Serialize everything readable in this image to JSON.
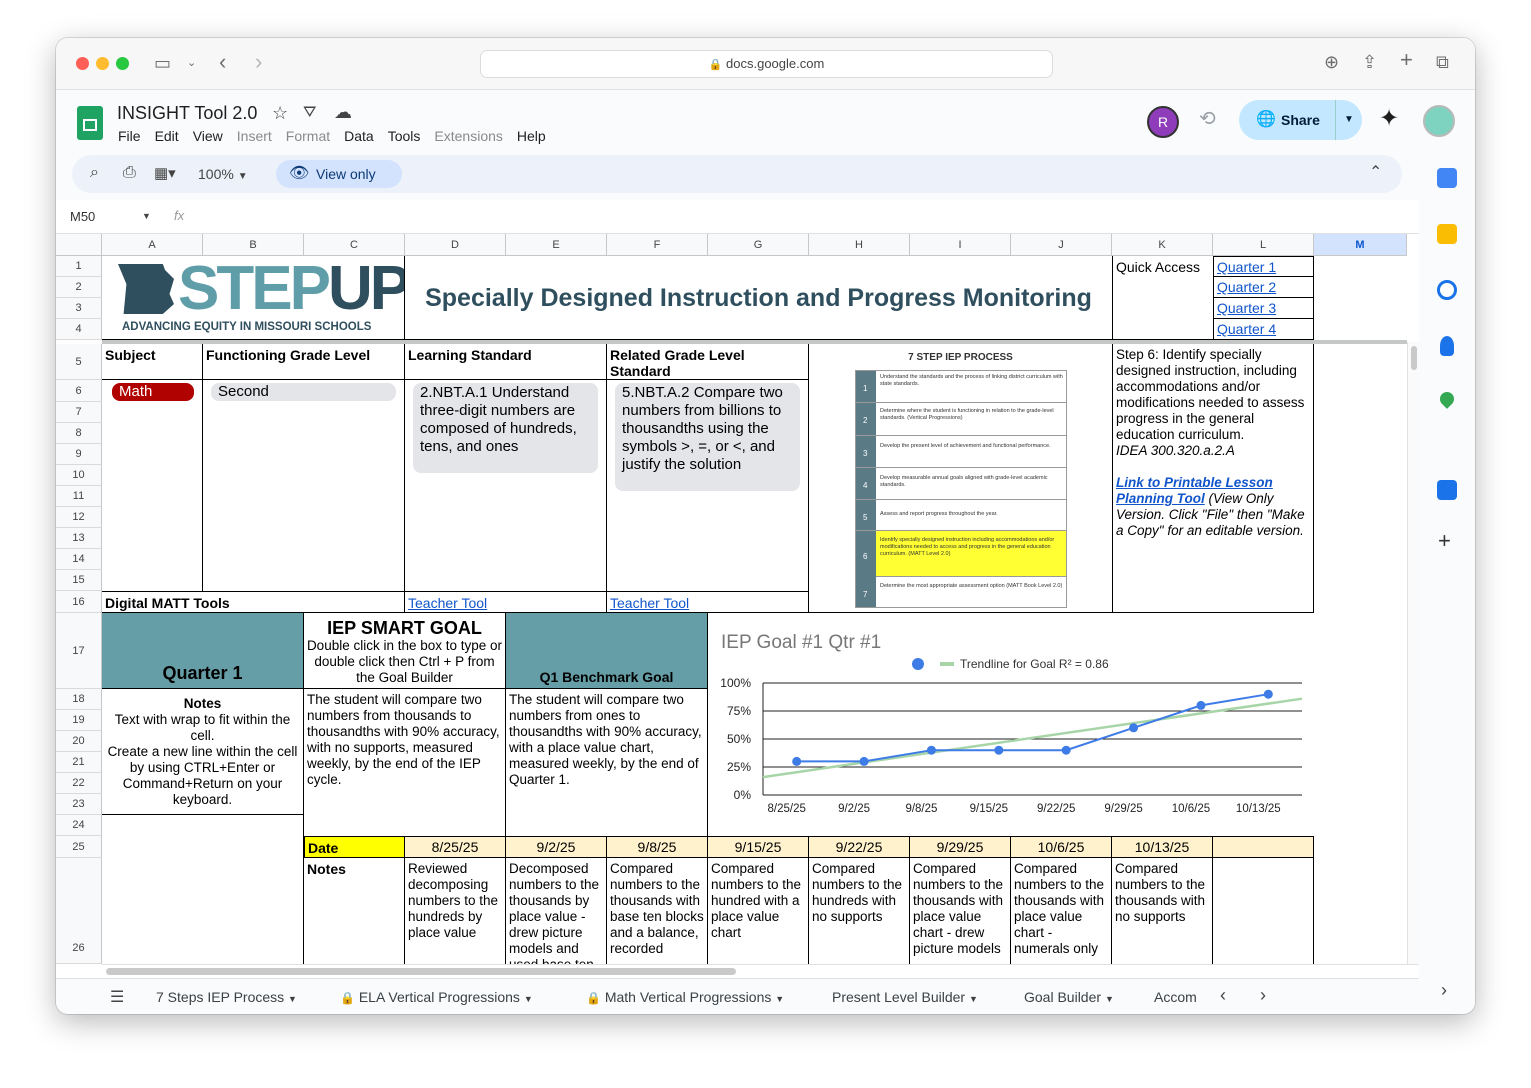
{
  "browser": {
    "url": "docs.google.com"
  },
  "app": {
    "title": "INSIGHT Tool 2.0",
    "menu": [
      "File",
      "Edit",
      "View",
      "Insert",
      "Format",
      "Data",
      "Tools",
      "Extensions",
      "Help"
    ],
    "zoom": "100%",
    "view_only": "View only",
    "share": "Share",
    "avatar_letter": "R",
    "name_box": "M50",
    "fx": "fx"
  },
  "columns": [
    "A",
    "B",
    "C",
    "D",
    "E",
    "F",
    "G",
    "H",
    "I",
    "J",
    "K",
    "L",
    "M"
  ],
  "rows": [
    "1",
    "2",
    "3",
    "4",
    "5",
    "6",
    "7",
    "8",
    "9",
    "10",
    "11",
    "12",
    "13",
    "14",
    "15",
    "16",
    "17",
    "18",
    "19",
    "20",
    "21",
    "22",
    "23",
    "24",
    "25",
    "26"
  ],
  "logo": {
    "word_a": "STEP",
    "word_b": "UP",
    "tagline": "ADVANCING EQUITY IN MISSOURI SCHOOLS"
  },
  "banner_title": "Specially Designed Instruction and Progress Monitoring",
  "quick_access": {
    "label": "Quick Access",
    "links": [
      "Quarter 1",
      "Quarter 2",
      "Quarter 3",
      "Quarter 4"
    ]
  },
  "headers": {
    "subject": "Subject",
    "grade": "Functioning Grade Level",
    "standard": "Learning Standard",
    "related": "Related Grade Level Standard",
    "digital": "Digital MATT Tools"
  },
  "values": {
    "subject": "Math",
    "grade": "Second",
    "standard": "2.NBT.A.1 Understand three-digit numbers are composed of hundreds, tens, and ones",
    "related": "5.NBT.A.2 Compare two numbers from billions to thousandths using the symbols >, =, or <, and justify the solution"
  },
  "teacher_tool": "Teacher Tool",
  "iep_image": {
    "title": "7 STEP IEP PROCESS",
    "steps": [
      "Understand the standards and the process of linking district curriculum with state standards.",
      "Determine where the student is functioning in relation to the grade-level standards. (Vertical Progressions)",
      "Develop the present level of achievement and functional performance.",
      "Develop measurable annual goals aligned with grade-level academic standards.",
      "Assess and report progress throughout the year.",
      "Identify specially designed instruction including accommodations and/or modifications needed to access and progress in the general education curriculum. (MATT Level 2.0)",
      "Determine the most appropriate assessment option (MATT Book Level 2.0)"
    ]
  },
  "step6": {
    "text": "Step 6: Identify specially designed instruction, including accommodations and/or modifications needed to assess progress in the general education curriculum.",
    "cite": "IDEA 300.320.a.2.A",
    "link": "Link to Printable Lesson Planning Tool",
    "note": " (View Only Version. Click \"File\" then \"Make a Copy\" for an editable version."
  },
  "quarter": "Quarter 1",
  "smart_goal": {
    "title": "IEP SMART GOAL",
    "hint": "Double click in the box to type or double click then Ctrl + P from the Goal Builder"
  },
  "benchmark_label": "Q1 Benchmark Goal",
  "notes_box": {
    "title": "Notes",
    "lines": [
      "Text with wrap to fit within the cell.",
      "Create a new line within the cell by using CTRL+Enter or Command+Return on your keyboard."
    ]
  },
  "goal_text": "The student will compare two numbers from thousands to thousandths with 90% accuracy, with no supports, measured weekly, by the end of the IEP cycle.",
  "benchmark_text": "The student will compare two numbers from ones to thousandths with 90% accuracy, with a place value chart, measured weekly, by the end of Quarter 1.",
  "date_label": "Date",
  "notes_label": "Notes",
  "dates": [
    "8/25/25",
    "9/2/25",
    "9/8/25",
    "9/15/25",
    "9/22/25",
    "9/29/25",
    "10/6/25",
    "10/13/25"
  ],
  "notes": [
    "Reviewed decomposing numbers to the hundreds by place value",
    "Decomposed numbers to the thousands by place value - drew picture models and used base ten",
    "Compared numbers to the thousands with base ten blocks and a balance, recorded",
    "Compared numbers to the hundred with a place value chart",
    "Compared numbers to the hundreds with no supports",
    "Compared numbers to the thousands with place value chart - drew picture models",
    "Compared numbers to the thousands with place value chart - numerals only",
    "Compared numbers to the thousands with no supports"
  ],
  "chart_data": {
    "type": "line",
    "title": "IEP Goal #1 Qtr #1",
    "legend": "Trendline for Goal R² = 0.86",
    "categories": [
      "8/25/25",
      "9/2/25",
      "9/8/25",
      "9/15/25",
      "9/22/25",
      "9/29/25",
      "10/6/25",
      "10/13/25"
    ],
    "series": [
      {
        "values": [
          0.3,
          0.3,
          0.4,
          0.4,
          0.4,
          0.6,
          0.8,
          0.9
        ],
        "color": "#3d7be6"
      }
    ],
    "trendline": {
      "start": 0.16,
      "end": 0.86,
      "color": "#a8d5a8"
    },
    "ylim": [
      0,
      1
    ],
    "yticks": [
      "0%",
      "25%",
      "50%",
      "75%",
      "100%"
    ],
    "legend_position": "top"
  },
  "sheet_tabs": [
    "7 Steps IEP Process",
    "ELA Vertical Progressions",
    "Math Vertical Progressions",
    "Present Level Builder",
    "Goal Builder",
    "Accom"
  ]
}
